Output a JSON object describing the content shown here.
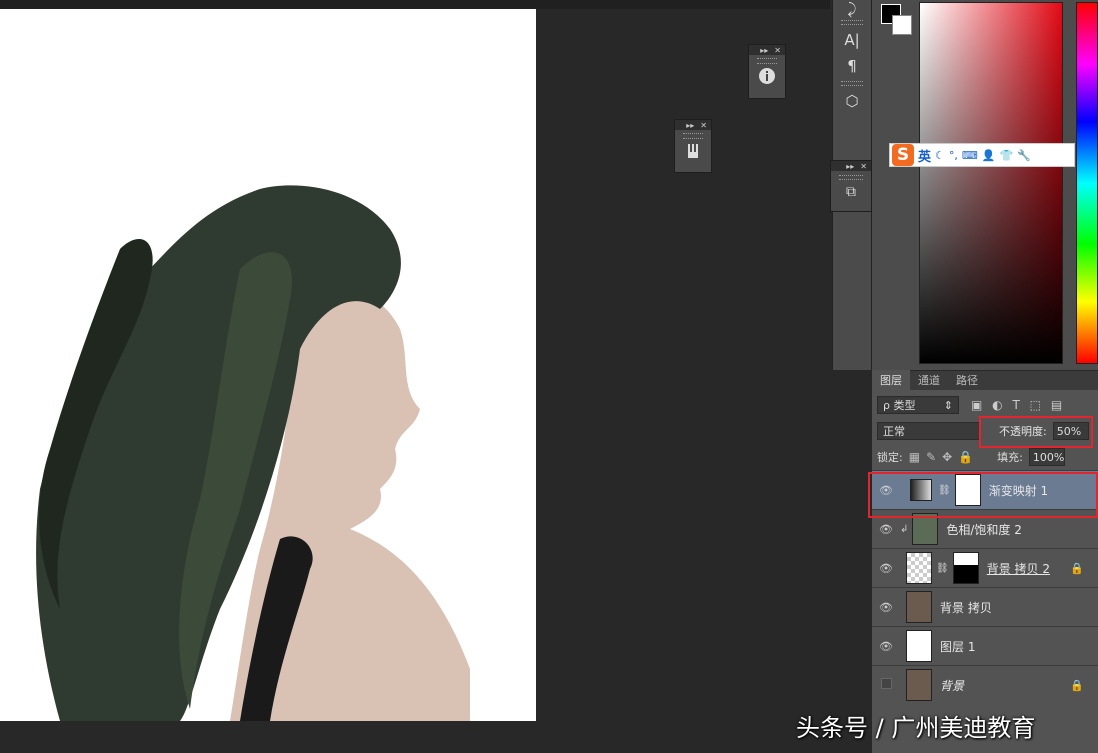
{
  "color_panel": {
    "fg_color": "#000000",
    "bg_color": "#ffffff",
    "picker_hue": "#e30a16"
  },
  "ime_toolbar": {
    "logo": "S",
    "lang": "英",
    "icons": [
      "moon-icon",
      "punctuation-icon",
      "keyboard-icon",
      "user-icon",
      "shirt-icon",
      "wrench-icon"
    ]
  },
  "tool_strip": {
    "tools": [
      "A|",
      "¶"
    ]
  },
  "layers_panel": {
    "tabs": [
      "图层",
      "通道",
      "路径"
    ],
    "filter_label": "ρ 类型",
    "blend_mode": "正常",
    "opacity_label": "不透明度:",
    "opacity_value": "50%",
    "lock_label": "锁定:",
    "fill_label": "填充:",
    "fill_value": "100%",
    "layers": [
      {
        "name": "渐变映射 1",
        "visible": true,
        "selected": true,
        "locked": false
      },
      {
        "name": "色相/饱和度 2",
        "visible": true,
        "selected": false,
        "locked": false
      },
      {
        "name": "背景 拷贝 2",
        "visible": true,
        "selected": false,
        "locked": true
      },
      {
        "name": "背景 拷贝",
        "visible": true,
        "selected": false,
        "locked": false
      },
      {
        "name": "图层 1",
        "visible": true,
        "selected": false,
        "locked": false
      },
      {
        "name": "背景",
        "visible": false,
        "selected": false,
        "locked": true
      }
    ]
  },
  "watermark": "头条号 / 广州美迪教育"
}
